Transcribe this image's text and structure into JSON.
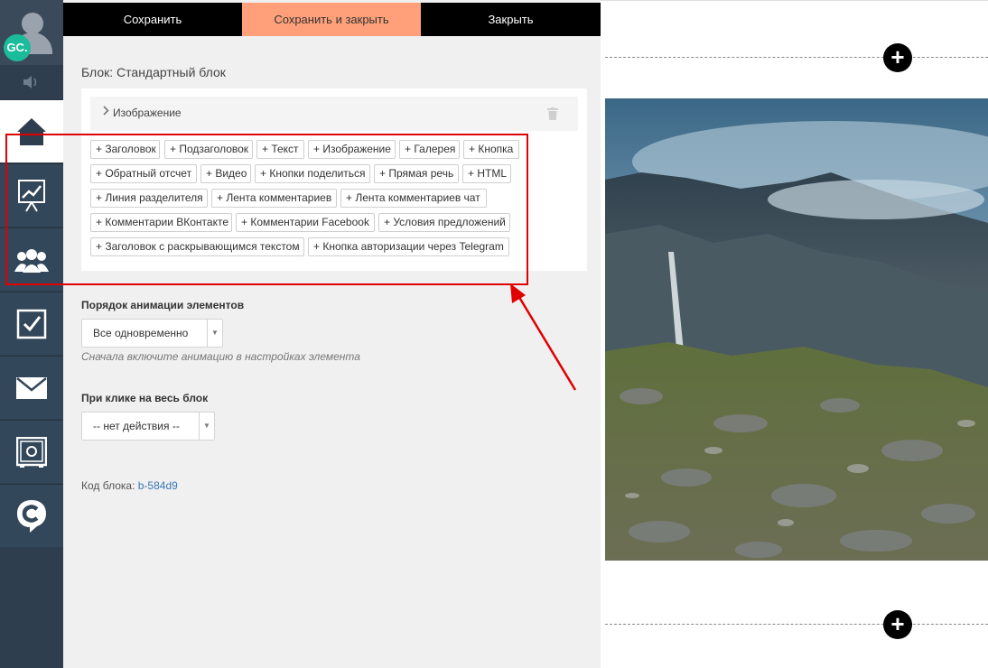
{
  "user": {
    "initials": "GC."
  },
  "nav": {
    "items": [
      {
        "name": "home-icon",
        "active": true
      },
      {
        "name": "chart-icon",
        "active": false
      },
      {
        "name": "users-icon",
        "active": false
      },
      {
        "name": "tasks-icon",
        "active": false
      },
      {
        "name": "mail-icon",
        "active": false
      },
      {
        "name": "safe-icon",
        "active": false
      },
      {
        "name": "brand-icon",
        "active": false
      }
    ]
  },
  "toolbar": {
    "save_label": "Сохранить",
    "save_close_label": "Сохранить и закрыть",
    "close_label": "Закрыть"
  },
  "block": {
    "title": "Блок: Стандартный блок",
    "image_row_label": "Изображение",
    "add_buttons": [
      "+ Заголовок",
      "+ Подзаголовок",
      "+ Текст",
      "+ Изображение",
      "+ Галерея",
      "+ Кнопка",
      "+ Обратный отсчет",
      "+ Видео",
      "+ Кнопки поделиться",
      "+ Прямая речь",
      "+ HTML",
      "+ Линия разделителя",
      "+ Лента комментариев",
      "+ Лента комментариев чат",
      "+ Комментарии ВКонтакте",
      "+ Комментарии Facebook",
      "+ Условия предложений",
      "+ Заголовок с раскрывающимся текстом",
      "+ Кнопка авторизации через Telegram"
    ]
  },
  "animation": {
    "label": "Порядок анимации элементов",
    "selected": "Все одновременно",
    "hint": "Сначала включите анимацию в настройках элемента"
  },
  "click_action": {
    "label": "При клике на весь блок",
    "selected": "-- нет действия --"
  },
  "block_code": {
    "label": "Код блока:",
    "value": "b-584d9"
  },
  "colors": {
    "accent": "#ffa07a",
    "highlight": "#e10000",
    "sidebar": "#2f3e4e",
    "badge": "#1bbc9b"
  }
}
